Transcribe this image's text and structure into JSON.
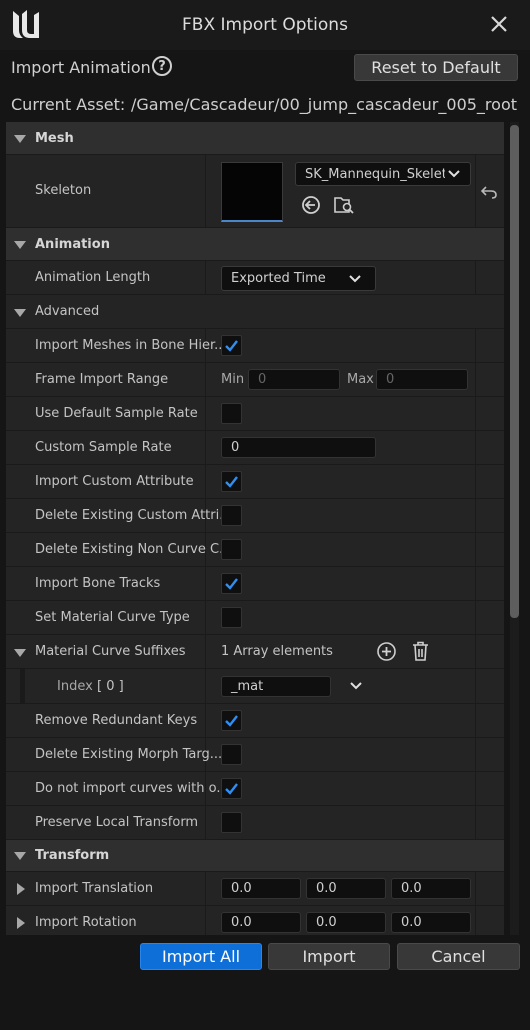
{
  "window": {
    "title": "FBX Import Options"
  },
  "header": {
    "import_type": "Import Animation",
    "reset_label": "Reset to Default"
  },
  "asset": {
    "label": "Current Asset:",
    "path": "/Game/Cascadeur/00_jump_cascadeur_005_root"
  },
  "sections": {
    "mesh": "Mesh",
    "skeleton": {
      "label": "Skeleton",
      "value": "SK_Mannequin_Skeleto"
    },
    "animation": "Animation",
    "animation_length": {
      "label": "Animation Length",
      "value": "Exported Time"
    },
    "advanced": "Advanced",
    "import_meshes_bone": {
      "label": "Import Meshes in Bone Hier...",
      "checked": true
    },
    "frame_range": {
      "label": "Frame Import Range",
      "min_label": "Min",
      "min_placeholder": "0",
      "max_label": "Max",
      "max_placeholder": "0"
    },
    "use_default_rate": {
      "label": "Use Default Sample Rate",
      "checked": false
    },
    "custom_rate": {
      "label": "Custom Sample Rate",
      "value": "0"
    },
    "import_custom_attr": {
      "label": "Import Custom Attribute",
      "checked": true
    },
    "delete_custom_attr": {
      "label": "Delete Existing Custom Attri...",
      "checked": false
    },
    "delete_non_curve": {
      "label": "Delete Existing Non Curve C...",
      "checked": false
    },
    "import_bone_tracks": {
      "label": "Import Bone Tracks",
      "checked": true
    },
    "set_material_curve": {
      "label": "Set Material Curve Type",
      "checked": false
    },
    "material_suffixes": {
      "label": "Material Curve Suffixes",
      "value": "1 Array elements"
    },
    "index0": {
      "label": "Index",
      "index": "[ 0 ]",
      "value": "_mat"
    },
    "remove_redundant": {
      "label": "Remove Redundant Keys",
      "checked": true
    },
    "delete_morph": {
      "label": "Delete Existing Morph Targ...",
      "checked": false
    },
    "no_import_curves": {
      "label": "Do not import curves with o...",
      "checked": true
    },
    "preserve_local": {
      "label": "Preserve Local Transform",
      "checked": false
    },
    "transform": "Transform",
    "import_translation": {
      "label": "Import Translation",
      "x": "0.0",
      "y": "0.0",
      "z": "0.0"
    },
    "import_rotation": {
      "label": "Import Rotation",
      "x": "0.0",
      "y": "0.0",
      "z": "0.0"
    }
  },
  "footer": {
    "import_all": "Import All",
    "import": "Import",
    "cancel": "Cancel"
  },
  "colors": {
    "accent": "#0e6fd8",
    "check": "#2f8ff3",
    "background": "#151515"
  }
}
